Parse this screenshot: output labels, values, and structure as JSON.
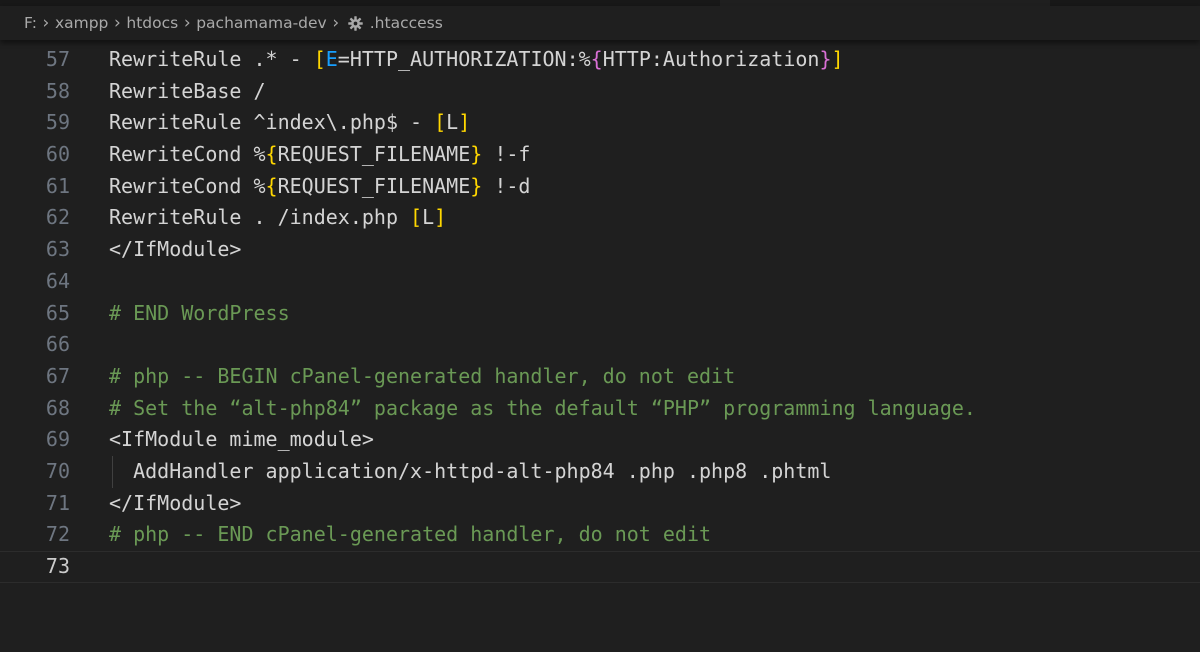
{
  "breadcrumb": {
    "items": [
      "F:",
      "xampp",
      "htdocs",
      "pachamama-dev"
    ],
    "file": ".htaccess",
    "file_icon": "gear-icon",
    "separator": "›"
  },
  "editor": {
    "lines": [
      {
        "n": "57",
        "t": "RewriteRule .* - [E=HTTP_AUTHORIZATION:%{HTTP:Authorization}]"
      },
      {
        "n": "58",
        "t": "RewriteBase /"
      },
      {
        "n": "59",
        "t": "RewriteRule ^index\\.php$ - [L]"
      },
      {
        "n": "60",
        "t": "RewriteCond %{REQUEST_FILENAME} !-f"
      },
      {
        "n": "61",
        "t": "RewriteCond %{REQUEST_FILENAME} !-d"
      },
      {
        "n": "62",
        "t": "RewriteRule . /index.php [L]"
      },
      {
        "n": "63",
        "t": "</IfModule>"
      },
      {
        "n": "64",
        "t": ""
      },
      {
        "n": "65",
        "t": "# END WordPress"
      },
      {
        "n": "66",
        "t": ""
      },
      {
        "n": "67",
        "t": "# php -- BEGIN cPanel-generated handler, do not edit"
      },
      {
        "n": "68",
        "t": "# Set the “alt-php84” package as the default “PHP” programming language."
      },
      {
        "n": "69",
        "t": "<IfModule mime_module>"
      },
      {
        "n": "70",
        "t": "  AddHandler application/x-httpd-alt-php84 .php .php8 .phtml"
      },
      {
        "n": "71",
        "t": "</IfModule>"
      },
      {
        "n": "72",
        "t": "# php -- END cPanel-generated handler, do not edit"
      },
      {
        "n": "73",
        "t": ""
      }
    ],
    "current_line": "73",
    "colors": {
      "background": "#1f1f1f",
      "text": "#d4d4d4",
      "comment": "#6a9955",
      "line_number": "#6e7681",
      "bracket_level1": "#ffd700",
      "bracket_level2": "#da70d6",
      "bracket_level3": "#179fff"
    }
  }
}
